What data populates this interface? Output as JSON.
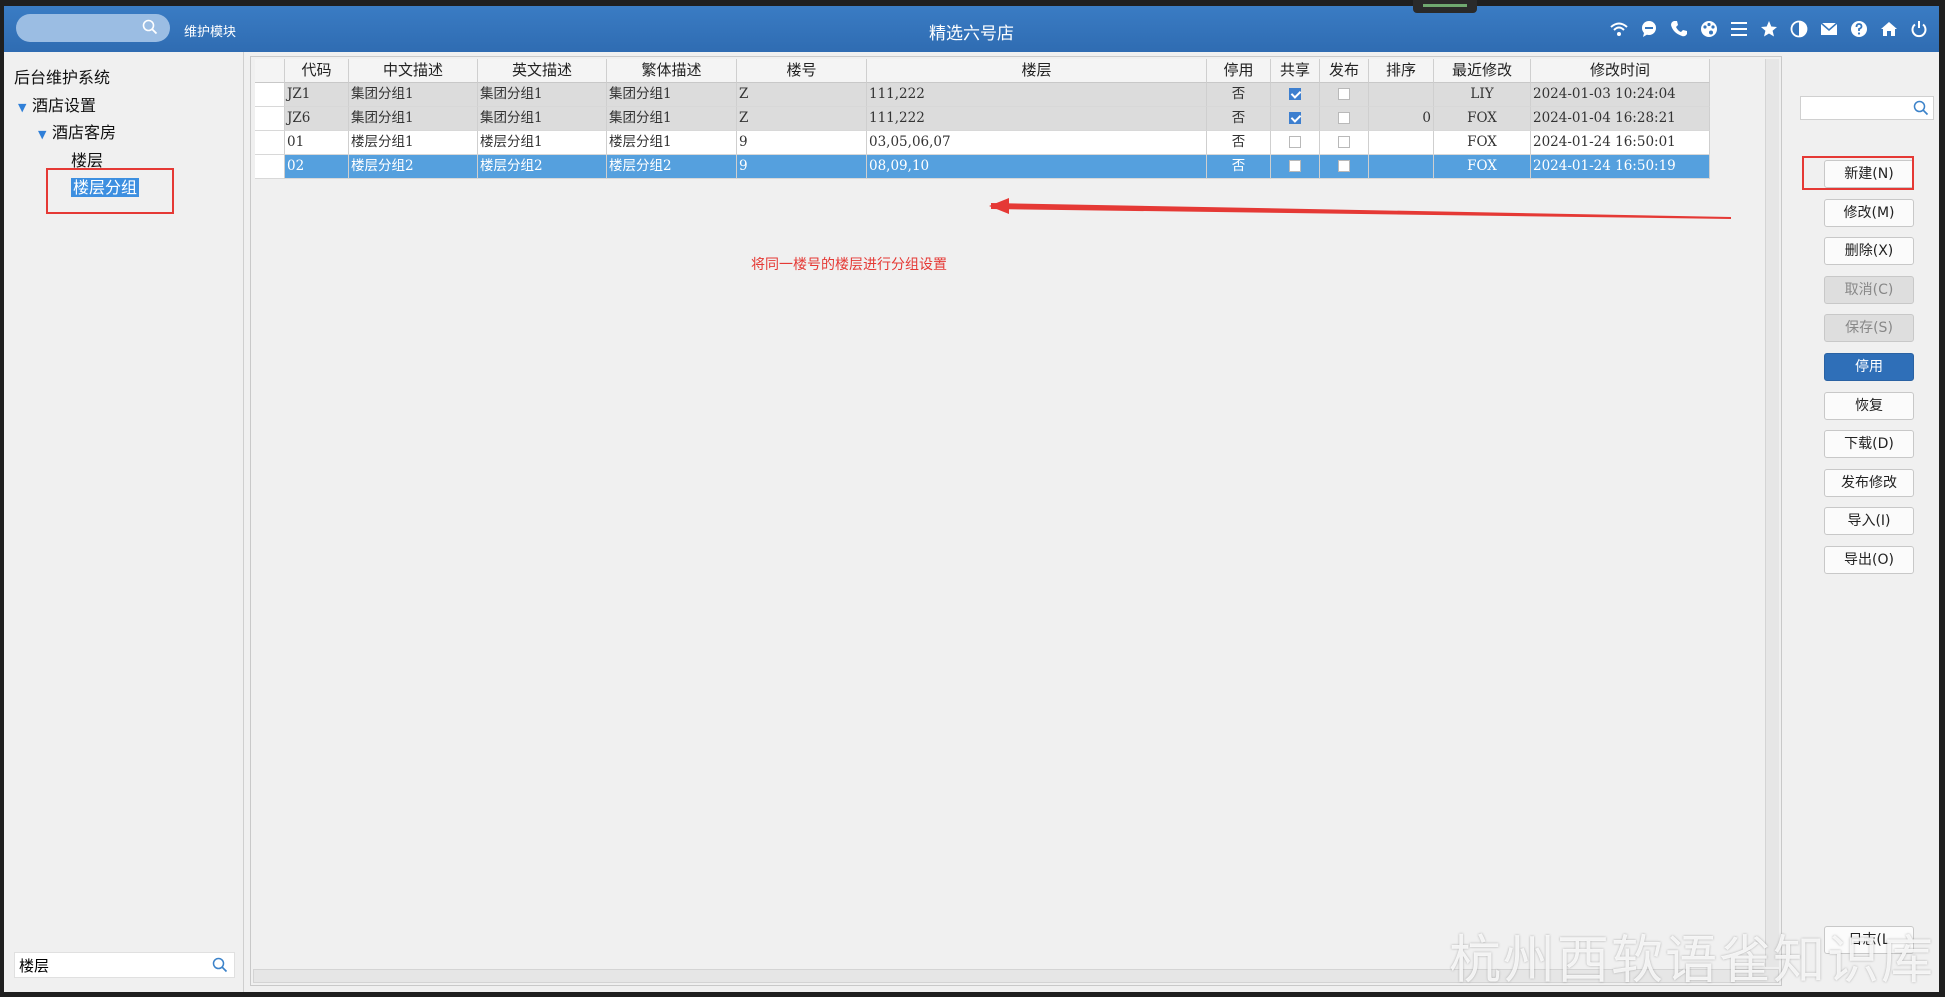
{
  "header": {
    "module": "维护模块",
    "title": "精选六号店",
    "icons": [
      "wifi-icon",
      "chat-icon",
      "phone-icon",
      "palette-icon",
      "menu-icon",
      "star-icon",
      "contrast-icon",
      "mail-icon",
      "help-icon",
      "home-icon",
      "power-icon"
    ]
  },
  "tree": {
    "root": "后台维护系统",
    "hotel_settings": "酒店设置",
    "hotel_rooms": "酒店客房",
    "floor": "楼层",
    "floor_group": "楼层分组",
    "search_value": "楼层"
  },
  "grid": {
    "columns": [
      "代码",
      "中文描述",
      "英文描述",
      "繁体描述",
      "楼号",
      "楼层",
      "停用",
      "共享",
      "发布",
      "排序",
      "最近修改",
      "修改时间"
    ],
    "rows": [
      {
        "code": "JZ1",
        "cn": "集团分组1",
        "en": "集团分组1",
        "tw": "集团分组1",
        "building": "Z",
        "floors": "111,222",
        "disabled": "否",
        "shared": true,
        "published": false,
        "sort": "",
        "modifier": "LIY",
        "time": "2024-01-03 10:24:04",
        "style": "gray"
      },
      {
        "code": "JZ6",
        "cn": "集团分组1",
        "en": "集团分组1",
        "tw": "集团分组1",
        "building": "Z",
        "floors": "111,222",
        "disabled": "否",
        "shared": true,
        "published": false,
        "sort": "0",
        "modifier": "FOX",
        "time": "2024-01-04 16:28:21",
        "style": "gray"
      },
      {
        "code": "01",
        "cn": "楼层分组1",
        "en": "楼层分组1",
        "tw": "楼层分组1",
        "building": "9",
        "floors": "03,05,06,07",
        "disabled": "否",
        "shared": false,
        "published": false,
        "sort": "",
        "modifier": "FOX",
        "time": "2024-01-24 16:50:01",
        "style": "white"
      },
      {
        "code": "02",
        "cn": "楼层分组2",
        "en": "楼层分组2",
        "tw": "楼层分组2",
        "building": "9",
        "floors": "08,09,10",
        "disabled": "否",
        "shared": false,
        "published": false,
        "sort": "",
        "modifier": "FOX",
        "time": "2024-01-24 16:50:19",
        "style": "sel"
      }
    ]
  },
  "annotation": "将同一楼号的楼层进行分组设置",
  "buttons": {
    "new": "新建(N)",
    "modify": "修改(M)",
    "delete": "删除(X)",
    "cancel": "取消(C)",
    "save": "保存(S)",
    "disable": "停用",
    "restore": "恢复",
    "download": "下载(D)",
    "publish": "发布修改",
    "import": "导入(I)",
    "export": "导出(O)",
    "log": "日志(L"
  },
  "watermark": "杭州西软语雀知识库",
  "colors": {
    "header": "#3375bd",
    "selected_row": "#55a0de",
    "annotation": "#e53935",
    "primary_button": "#2f6fb8"
  }
}
